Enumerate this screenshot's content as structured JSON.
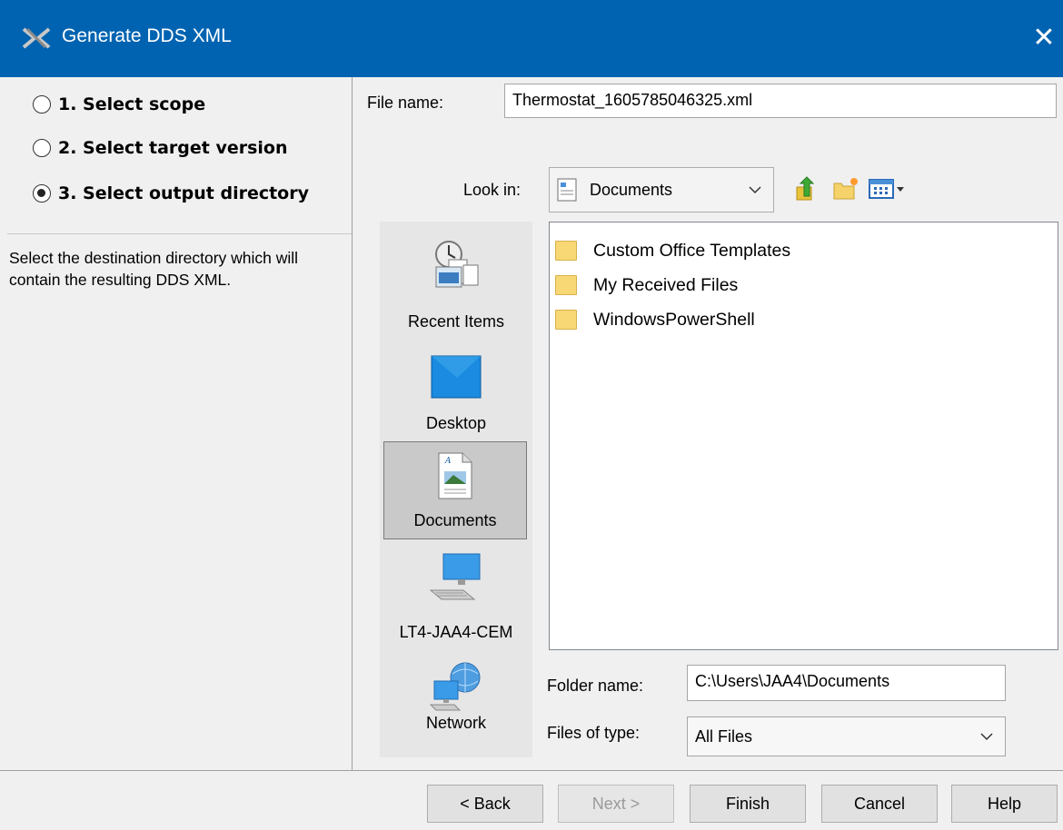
{
  "window": {
    "title": "Generate DDS XML",
    "close_glyph": "✕"
  },
  "steps": [
    {
      "label": "1. Select scope",
      "selected": false
    },
    {
      "label": "2. Select target version",
      "selected": false
    },
    {
      "label": "3. Select output directory",
      "selected": true
    }
  ],
  "description": "Select the destination directory which will contain the resulting DDS XML.",
  "file_name": {
    "label": "File name:",
    "value": "Thermostat_1605785046325.xml"
  },
  "look_in": {
    "label": "Look in:",
    "value": "Documents"
  },
  "places": [
    {
      "label": "Recent Items",
      "icon": "recent-items-icon"
    },
    {
      "label": "Desktop",
      "icon": "desktop-icon"
    },
    {
      "label": "Documents",
      "icon": "documents-icon",
      "selected": true
    },
    {
      "label": "LT4-JAA4-CEM",
      "icon": "computer-icon"
    },
    {
      "label": "Network",
      "icon": "network-icon"
    }
  ],
  "files": [
    {
      "name": "Custom Office Templates"
    },
    {
      "name": "My Received Files"
    },
    {
      "name": "WindowsPowerShell"
    }
  ],
  "folder_name": {
    "label": "Folder name:",
    "value": "C:\\Users\\JAA4\\Documents"
  },
  "files_of_type": {
    "label": "Files of type:",
    "value": "All Files"
  },
  "buttons": {
    "back": "< Back",
    "next": "Next >",
    "finish": "Finish",
    "cancel": "Cancel",
    "help": "Help"
  },
  "colors": {
    "titlebar": "#0063b1",
    "folder": "#f8d775"
  }
}
